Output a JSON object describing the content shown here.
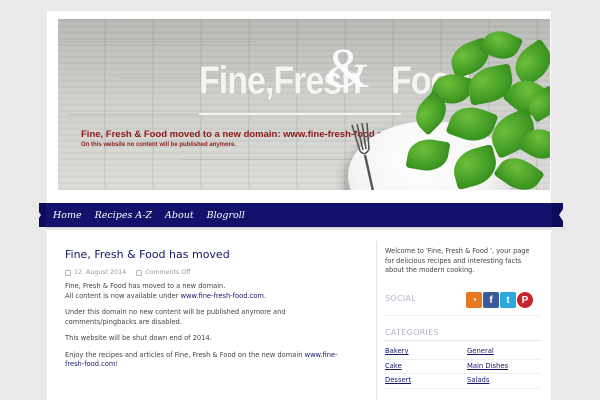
{
  "banner": {
    "title": "Fine,Fresh",
    "amp": "&",
    "title_end": "Food",
    "moved_text": "Fine, Fresh & Food moved to a new domain: www.fine-fresh-food.com",
    "note_text": "On this website no content will be published anymore."
  },
  "nav": {
    "items": [
      "Home",
      "Recipes A-Z",
      "About",
      "Blogroll"
    ]
  },
  "post": {
    "title": "Fine, Fresh & Food has moved",
    "date": "12. August 2014",
    "comments": "Comments Off",
    "p1_line1": "Fine, Fresh & Food has moved to a new domain.",
    "p1_line2_prefix": "All content is now available under ",
    "p1_link": "www.fine-fresh-food.com",
    "p1_line2_suffix": ".",
    "p2": "Under this domain no new content will be published anymore and comments/pingbacks are disabled.",
    "p3": "This website will be shut down end of 2014.",
    "p4_prefix": "Enjoy the recipes and articles of Fine, Fresh & Food on the new domain ",
    "p4_link": "www.fine-fresh-food.com",
    "p4_suffix": "!"
  },
  "sidebar": {
    "welcome": "Welcome to 'Fine, Fresh & Food ', your page for delicious recipes and interesting facts about the modern cooking.",
    "social_heading": "SOCIAL",
    "social_icons": [
      "rss-icon",
      "facebook-icon",
      "twitter-icon",
      "pinterest-icon"
    ],
    "social_glyphs": [
      "◔",
      "f",
      "t",
      "P"
    ],
    "categories_heading": "CATEGORIES",
    "categories": [
      "Bakery",
      "General",
      "Cake",
      "Main Dishes",
      "Dessert",
      "Salads"
    ]
  },
  "colors": {
    "nav": "#12126d",
    "link": "#16166e",
    "banner_red": "#8d1a1a",
    "rss": "#e8781f",
    "facebook": "#3b5a9a",
    "twitter": "#2aa9e0",
    "pinterest": "#c8232c"
  }
}
